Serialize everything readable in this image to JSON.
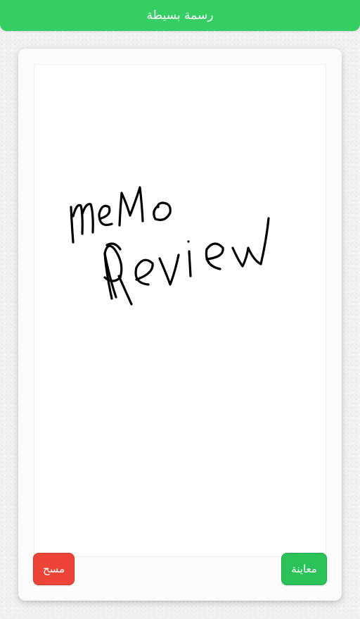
{
  "header": {
    "title": "رسمة بسيطة"
  },
  "drawing": {
    "stroke_color": "#000000",
    "content": "meMo Review"
  },
  "actions": {
    "clear_label": "مسح",
    "preview_label": "معاينة"
  },
  "colors": {
    "header_bg": "#34ce62",
    "clear_bg": "#ec4436",
    "preview_bg": "#2cc25a"
  }
}
